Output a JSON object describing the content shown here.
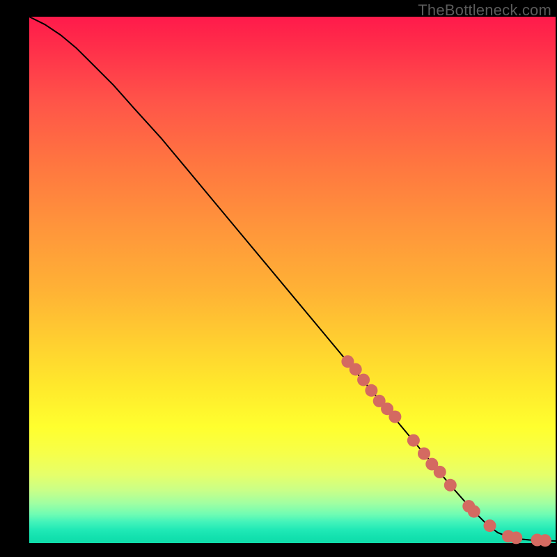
{
  "watermark": "TheBottleneck.com",
  "chart_data": {
    "type": "line",
    "title": "",
    "xlabel": "",
    "ylabel": "",
    "xlim": [
      0,
      100
    ],
    "ylim": [
      0,
      100
    ],
    "grid": false,
    "series": [
      {
        "name": "curve",
        "x": [
          0,
          3,
          6,
          9,
          12,
          16,
          20,
          25,
          30,
          35,
          40,
          45,
          50,
          55,
          60,
          65,
          70,
          75,
          80,
          84,
          87,
          89,
          91,
          93,
          95,
          97,
          100
        ],
        "y": [
          100,
          98.5,
          96.5,
          94,
          91,
          87,
          82.5,
          77,
          71,
          65,
          59,
          53,
          47,
          41,
          35,
          29,
          23,
          17,
          11,
          6.5,
          3.5,
          2,
          1.2,
          0.8,
          0.6,
          0.5,
          0.4
        ]
      },
      {
        "name": "highlight-dots",
        "x": [
          60.5,
          62.0,
          63.5,
          65.0,
          66.5,
          68.0,
          69.5,
          73.0,
          75.0,
          76.5,
          78.0,
          80.0,
          83.5,
          84.5,
          87.5,
          91.0,
          92.5,
          96.5,
          98.0
        ],
        "y": [
          34.5,
          33.0,
          31.0,
          29.0,
          27.0,
          25.5,
          24.0,
          19.5,
          17.0,
          15.0,
          13.5,
          11.0,
          7.0,
          6.0,
          3.3,
          1.3,
          1.0,
          0.6,
          0.5
        ]
      }
    ],
    "colors": {
      "curve": "#000000",
      "dots": "#d46a61",
      "bg_top": "#ff1a4b",
      "bg_bottom": "#10dca9"
    }
  }
}
